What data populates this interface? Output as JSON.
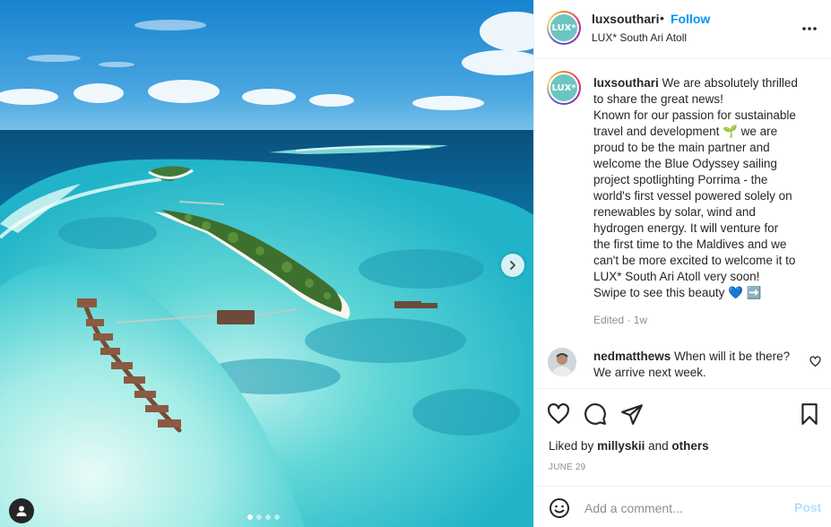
{
  "header": {
    "avatar_logo": "LUX*",
    "username": "luxsouthari",
    "separator": "•",
    "follow_label": "Follow",
    "location": "LUX* South Ari Atoll"
  },
  "caption": {
    "avatar_logo": "LUX*",
    "username": "luxsouthari",
    "lines": [
      "We are absolutely thrilled",
      "to share the great news!",
      "Known for our passion for sustainable",
      "travel and development 🌱 we are",
      "proud to be the main partner and",
      "welcome the Blue Odyssey sailing",
      "project spotlighting Porrima - the",
      "world's first vessel powered solely on",
      "renewables by solar, wind and",
      "hydrogen energy. It will venture for",
      "the first time to the Maldives and we",
      "can't be more excited to welcome it to",
      "LUX* South Ari Atoll very soon!",
      "Swipe to see this beauty 💙 ➡️"
    ],
    "edited_label": "Edited",
    "edited_sep": "·",
    "age": "1w"
  },
  "comment": {
    "username": "nedmatthews",
    "text_line1": "When will it be there?",
    "text_line2": "We arrive next week."
  },
  "likes": {
    "prefix": "Liked by",
    "user": "millyskii",
    "conjunction": "and",
    "others": "others"
  },
  "date": "JUNE 29",
  "add_comment": {
    "placeholder": "Add a comment...",
    "post_label": "Post"
  },
  "carousel": {
    "slide_count": 4,
    "active_index": 0
  },
  "colors": {
    "accent": "#0095f6",
    "post_disabled": "#b2dffc",
    "muted": "#8e8e8e",
    "text": "#262626"
  },
  "icons": {
    "more": "more-horizontal-icon",
    "next": "chevron-right-icon",
    "tag": "user-tag-icon",
    "like": "heart-icon",
    "comment": "comment-icon",
    "share": "send-icon",
    "save": "bookmark-icon",
    "emoji": "emoji-icon",
    "comment_like": "heart-small-icon"
  }
}
